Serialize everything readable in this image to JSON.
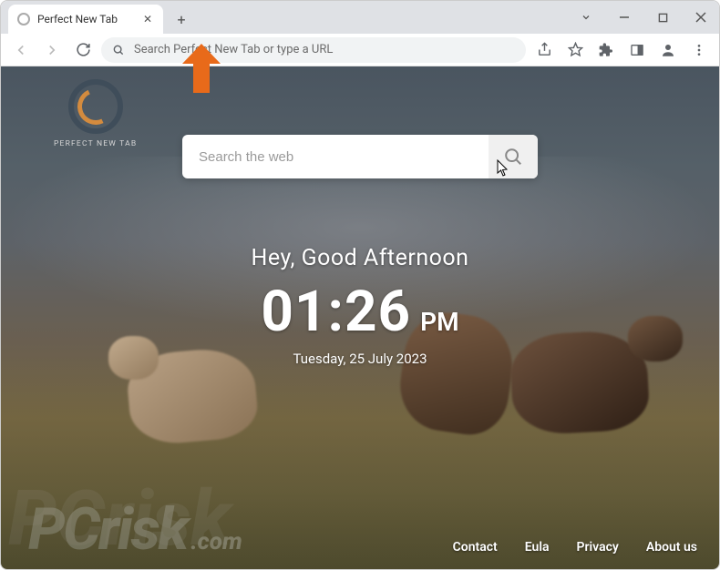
{
  "window": {
    "tab_title": "Perfect New Tab",
    "minimize_icon": "minimize-icon",
    "maximize_icon": "maximize-icon",
    "close_icon": "close-icon",
    "caret_icon": "chevron-down-icon"
  },
  "toolbar": {
    "omnibox_placeholder": "Search Perfect New Tab or type a URL"
  },
  "logo": {
    "text": "PERFECT NEW TAB"
  },
  "search": {
    "placeholder": "Search the web"
  },
  "greeting": "Hey, Good Afternoon",
  "clock": {
    "time": "01:26",
    "ampm": "PM"
  },
  "date": "Tuesday, 25 July 2023",
  "footer": {
    "links": [
      "Contact",
      "Eula",
      "Privacy",
      "About us"
    ]
  },
  "annotation": {
    "arrow_color": "#e86a1a"
  },
  "watermark": {
    "main": "PCrisk",
    "domain": ".com"
  }
}
